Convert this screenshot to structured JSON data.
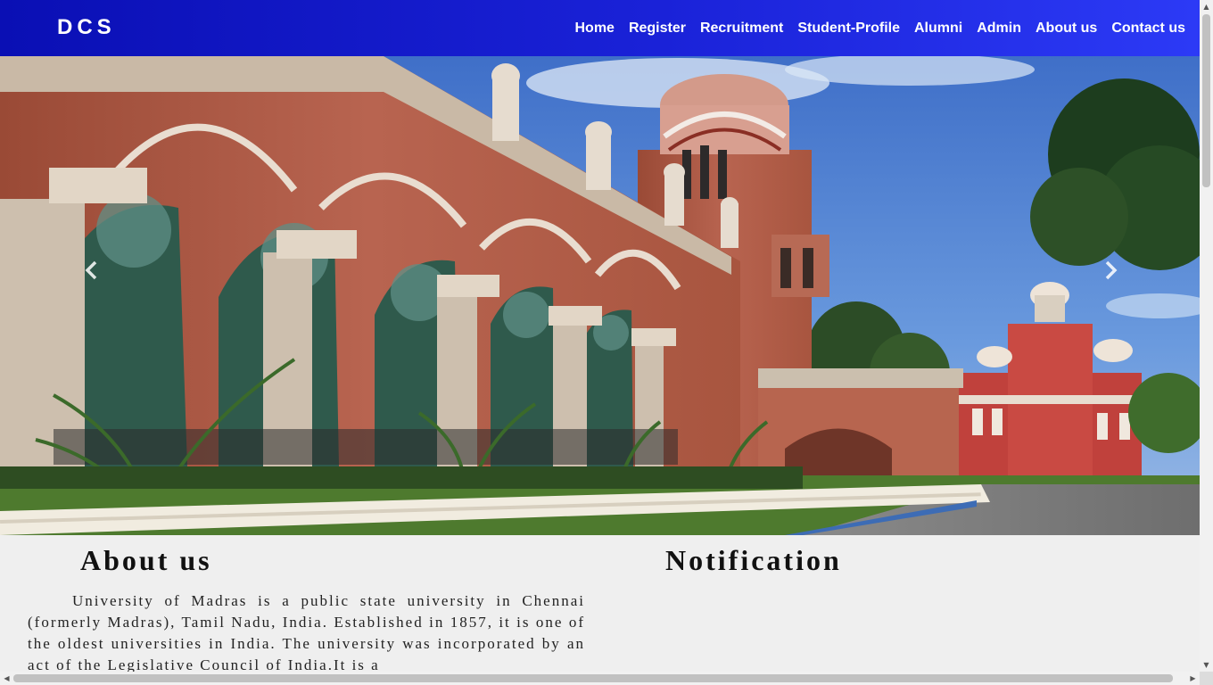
{
  "navbar": {
    "brand": "DCS",
    "links": [
      "Home",
      "Register",
      "Recruitment",
      "Student-Profile",
      "Alumni",
      "Admin",
      "About us",
      "Contact us"
    ]
  },
  "carousel": {
    "prev_icon": "chevron-left-icon",
    "next_icon": "chevron-right-icon"
  },
  "about": {
    "heading": "About us",
    "text": "University of Madras is a public state university in Chennai (formerly Madras), Tamil Nadu, India. Established in 1857, it is one of the oldest universities in India. The university was incorporated by an act of the Legislative Council of India.It is a"
  },
  "notification": {
    "heading": "Notification"
  },
  "colors": {
    "nav_start": "#0a0fb4",
    "nav_end": "#2c3af6",
    "page_bg": "#efefef"
  }
}
